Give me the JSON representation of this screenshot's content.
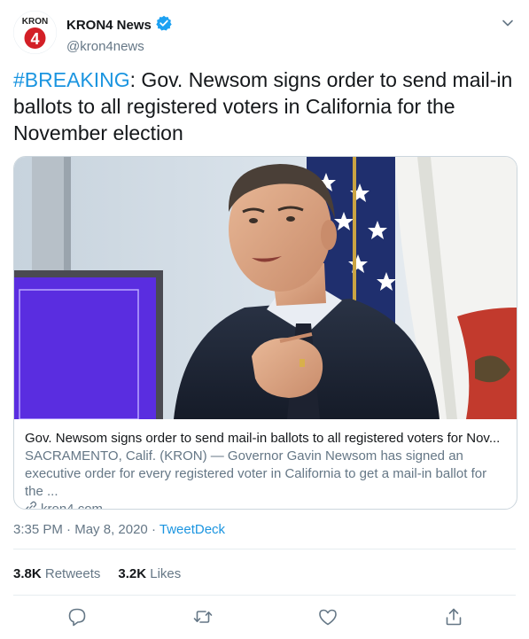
{
  "account": {
    "logo_top": "KRON",
    "logo_number": "4",
    "name": "KRON4 News",
    "handle": "@kron4news",
    "verified": true
  },
  "tweet": {
    "hashtag": "#BREAKING",
    "text_rest": ": Gov. Newsom signs order to send mail-in ballots to all registered voters in California for the November election"
  },
  "card": {
    "title": "Gov. Newsom signs order to send mail-in ballots to all registered voters for Nov...",
    "description": "SACRAMENTO, Calif. (KRON) — Governor Gavin Newsom has signed an executive order for every registered voter in California to get a mail-in ballot for the ...",
    "domain": "kron4.com",
    "icon": "link-icon"
  },
  "meta": {
    "time": "3:35 PM",
    "separator": "·",
    "date": "May 8, 2020",
    "source": "TweetDeck"
  },
  "stats": {
    "retweets_count": "3.8K",
    "retweets_label": "Retweets",
    "likes_count": "3.2K",
    "likes_label": "Likes"
  },
  "actions": [
    "reply-icon",
    "retweet-icon",
    "like-icon",
    "share-icon"
  ],
  "colors": {
    "link_blue": "#1b95e0",
    "text": "#14171a",
    "muted": "#657786",
    "border": "#ccd6dd",
    "kron_red": "#d31f26"
  }
}
